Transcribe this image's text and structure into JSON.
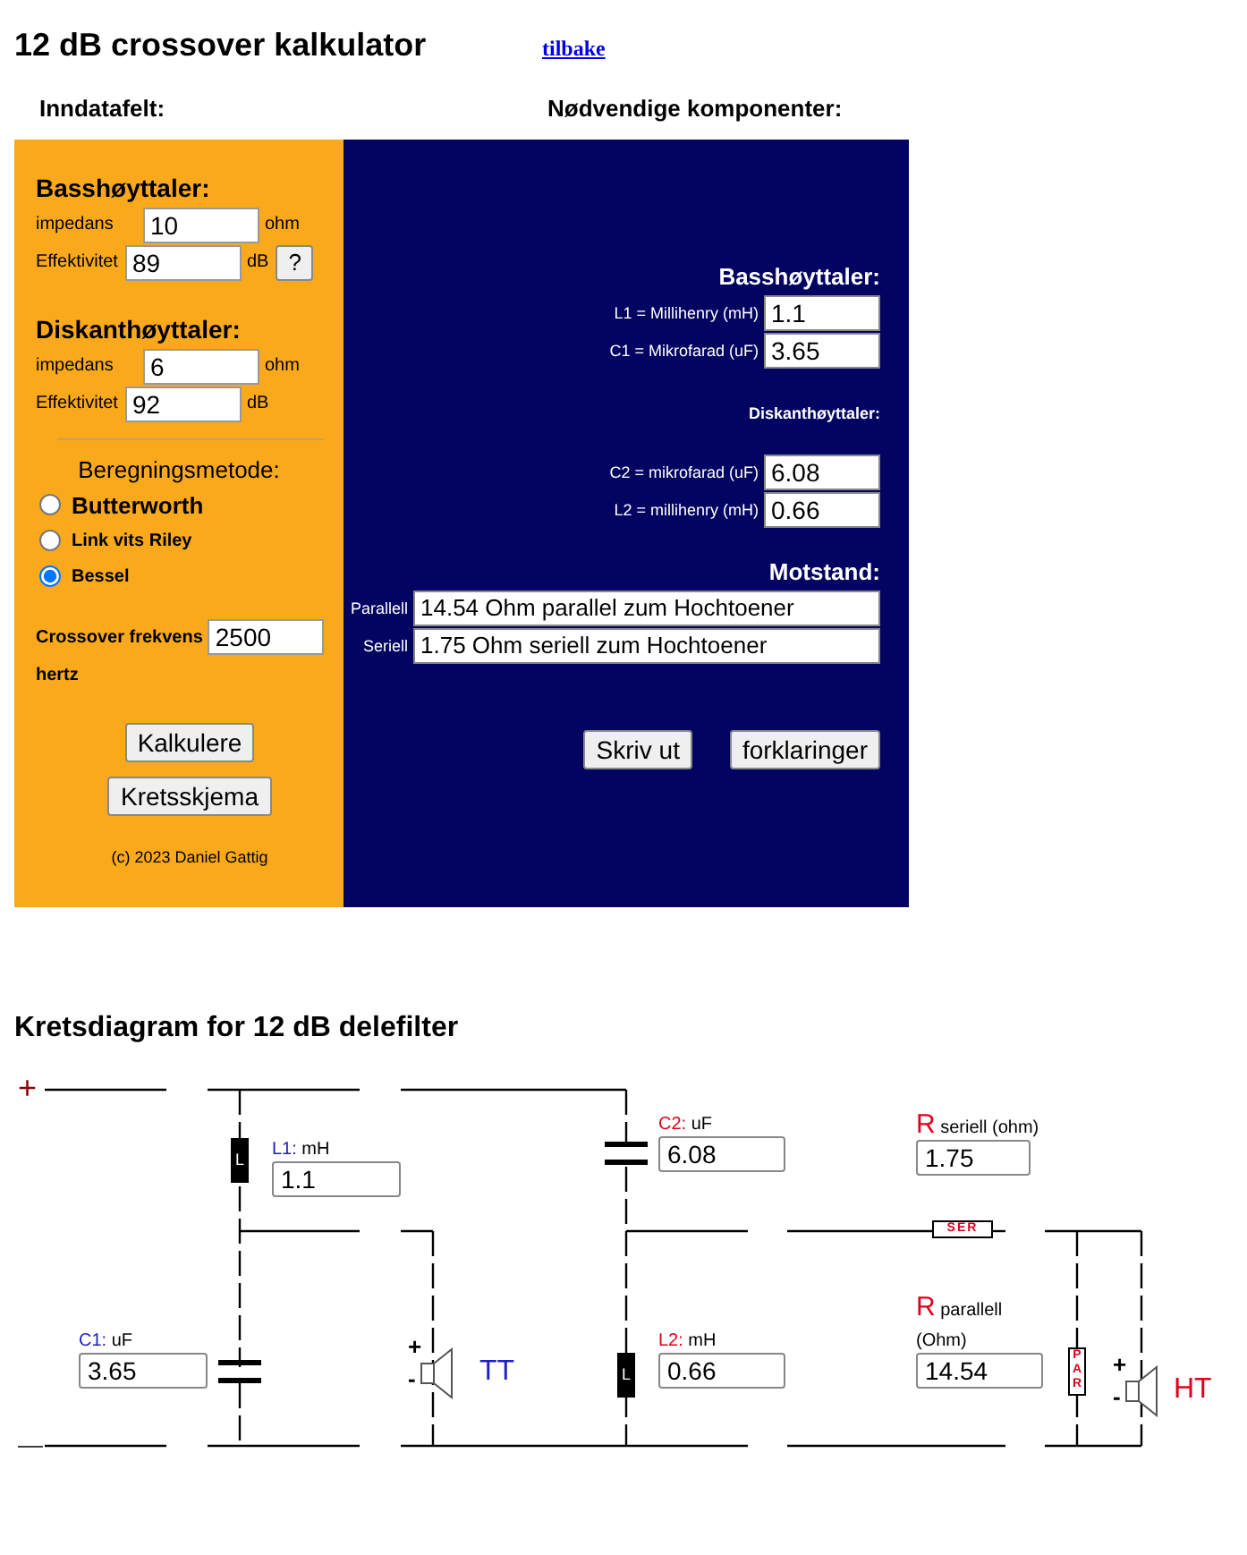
{
  "title": "12 dB crossover kalkulator",
  "back_link": "tilbake",
  "input_panel": {
    "heading": "Inndatafelt:",
    "speakers": [
      {
        "heading": "Basshøyttaler:",
        "fields": [
          {
            "label": "impedans",
            "value": "10",
            "unit": "ohm"
          },
          {
            "label": "Effektivitet",
            "value": "89",
            "unit": "dB",
            "help": "?"
          }
        ]
      },
      {
        "heading": "Diskanthøyttaler:",
        "fields": [
          {
            "label": "impedans",
            "value": "6",
            "unit": "ohm"
          },
          {
            "label": "Effektivitet",
            "value": "92",
            "unit": "dB"
          }
        ]
      }
    ],
    "method": {
      "heading": "Beregningsmetode:",
      "options": [
        {
          "label": "Butterworth",
          "selected": false
        },
        {
          "label": "Link vits Riley",
          "selected": false
        },
        {
          "label": "Bessel",
          "selected": true
        }
      ]
    },
    "frequency": {
      "label": "Crossover frekvens",
      "value": "2500",
      "unit": "hertz"
    },
    "buttons": [
      "Kalkulere",
      "Kretsskjema"
    ],
    "copyright": "(c) 2023 Daniel Gattig"
  },
  "results_panel": {
    "heading": "Nødvendige komponenter:",
    "woofer": {
      "heading": "Basshøyttaler:",
      "fields": [
        {
          "label": "L1 = Millihenry (mH)",
          "value": "1.1"
        },
        {
          "label": "C1 = Mikrofarad (uF)",
          "value": "3.65"
        }
      ]
    },
    "tweeter": {
      "heading": "Diskanthøyttaler:",
      "fields": [
        {
          "label": "C2 = mikrofarad (uF)",
          "value": "6.08"
        },
        {
          "label": "L2 = millihenry (mH)",
          "value": "0.66"
        }
      ]
    },
    "resistors": {
      "heading": "Motstand:",
      "fields": [
        {
          "label": "Parallell",
          "value": "14.54 Ohm parallel zum Hochtoener"
        },
        {
          "label": "Seriell",
          "value": "1.75 Ohm seriell zum Hochtoener"
        }
      ]
    },
    "buttons": [
      "Skriv ut",
      "forklaringer"
    ]
  },
  "diagram": {
    "heading": "Kretsdiagram for 12 dB delefilter",
    "plus": "+",
    "minus": "—",
    "fields": [
      {
        "prefix": "L1:",
        "unit": "mH",
        "value": "1.1",
        "color": "#2020c0"
      },
      {
        "prefix": "C1:",
        "unit": "uF",
        "value": "3.65",
        "color": "#2020c0"
      },
      {
        "prefix": "C2:",
        "unit": "uF",
        "value": "6.08",
        "color": "#e0001b"
      },
      {
        "prefix": "L2:",
        "unit": "mH",
        "value": "0.66",
        "color": "#e0001b"
      },
      {
        "prefix": "R",
        "unit": "seriell (ohm)",
        "value": "1.75",
        "color": "#e0001b"
      },
      {
        "prefix": "R",
        "unit": "parallell",
        "note": "(Ohm)",
        "value": "14.54",
        "color": "#e0001b"
      }
    ],
    "symbols": [
      {
        "kind": "inductor",
        "text": "L"
      },
      {
        "kind": "inductor",
        "text": "L"
      },
      {
        "kind": "capacitor"
      },
      {
        "kind": "capacitor"
      },
      {
        "kind": "resistor",
        "text": "SER"
      },
      {
        "kind": "resistor",
        "text": "PAR"
      }
    ],
    "speakers": [
      {
        "label": "TT",
        "plus": "+",
        "minus": "-",
        "color": "#2020c0"
      },
      {
        "label": "HT",
        "plus": "+",
        "minus": "-",
        "color": "#e0001b"
      }
    ]
  }
}
